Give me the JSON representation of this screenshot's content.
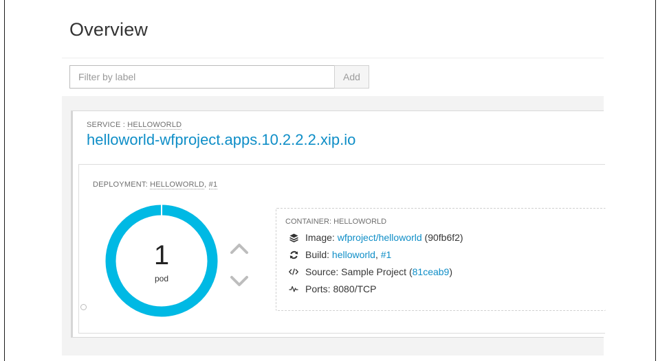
{
  "page": {
    "title": "Overview"
  },
  "filter": {
    "placeholder": "Filter by label",
    "value": "",
    "add_label": "Add"
  },
  "service": {
    "label_prefix": "SERVICE : ",
    "name": "HELLOWORLD",
    "url": "helloworld-wfproject.apps.10.2.2.2.xip.io"
  },
  "deployment": {
    "label_prefix": "DEPLOYMENT: ",
    "name": "HELLOWORLD",
    "separator": ", ",
    "revision": "#1",
    "pods": {
      "count": "1",
      "unit": "pod",
      "ready_fraction": 1.0
    },
    "container": {
      "label": "CONTAINER: HELLOWORLD",
      "image": {
        "label": "Image: ",
        "link": "wfproject/helloworld",
        "suffix": " (90fb6f2)"
      },
      "build": {
        "label": "Build: ",
        "link": "helloworld",
        "separator": ", ",
        "link2": "#1"
      },
      "source": {
        "label": "Source: Sample Project (",
        "link": "81ceab9",
        "suffix": ")"
      },
      "ports": {
        "label": "Ports: 8080/TCP"
      }
    }
  },
  "colors": {
    "accent": "#00b9e4",
    "link": "#0f8ec7",
    "chevron": "#bdbdbd"
  },
  "icons": {
    "image": "layers-icon",
    "build": "refresh-icon",
    "source": "code-icon",
    "ports": "pulse-icon",
    "scale_up": "chevron-up-icon",
    "scale_down": "chevron-down-icon"
  }
}
